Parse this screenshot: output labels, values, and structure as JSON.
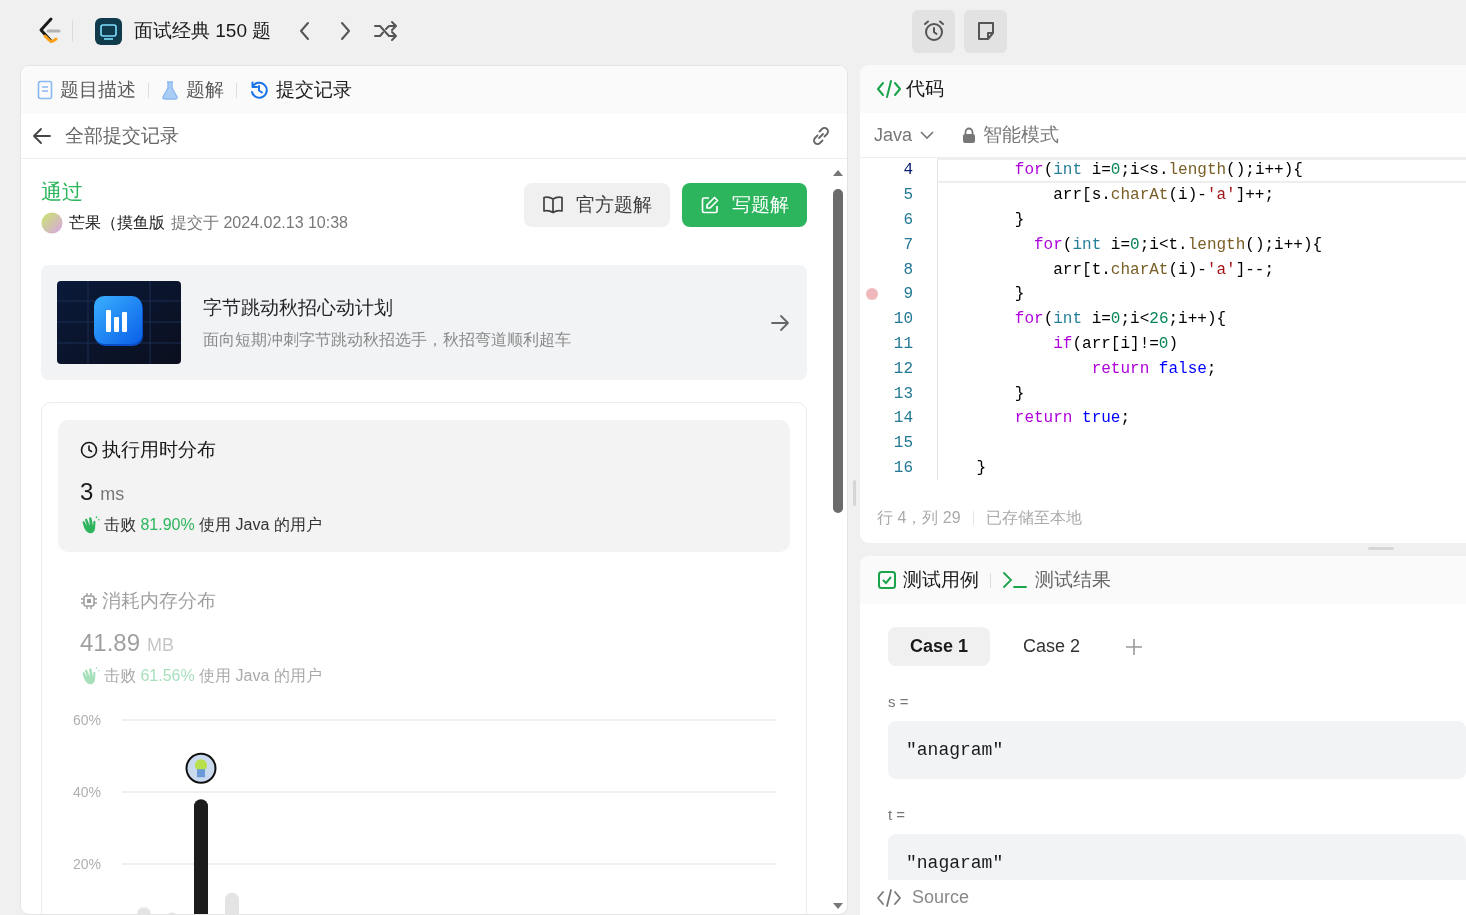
{
  "top_bar": {
    "study_plan_title": "面试经典 150 题"
  },
  "left_panel": {
    "tabs": [
      {
        "label": "题目描述",
        "selected": false
      },
      {
        "label": "题解",
        "selected": false
      },
      {
        "label": "提交记录",
        "selected": true
      }
    ],
    "back_link": "全部提交记录",
    "submission": {
      "status": "通过",
      "user": "芒果（摸鱼版",
      "submitted_at": "提交于 2024.02.13 10:38",
      "buttons": [
        {
          "label": "官方题解",
          "primary": false
        },
        {
          "label": "写题解",
          "primary": true
        }
      ]
    },
    "promo": {
      "title": "字节跳动秋招心动计划",
      "subtitle": "面向短期冲刺字节跳动秋招选手，秋招弯道顺利超车"
    },
    "stats": [
      {
        "title": "执行用时分布",
        "value": "3",
        "unit": "ms",
        "beats_label": "击败",
        "beats": "81.90%",
        "beats_suffix": "使用 Java 的用户",
        "selected": true
      },
      {
        "title": "消耗内存分布",
        "value": "41.89",
        "unit": "MB",
        "beats_label": "击败",
        "beats": "61.56%",
        "beats_suffix": "使用 Java 的用户",
        "selected": false
      }
    ],
    "distribution_chart": {
      "tick_labels": [
        "60%",
        "40%",
        "20%"
      ]
    }
  },
  "code_panel": {
    "title": "代码",
    "language": "Java",
    "mode": "智能模式",
    "lines": [
      {
        "number": "4",
        "current": true,
        "breakpoint": false,
        "tokens": [
          {
            "kind": "keyword",
            "text": "        for"
          },
          {
            "kind": "plain",
            "text": "("
          },
          {
            "kind": "type",
            "text": "int"
          },
          {
            "kind": "plain",
            "text": " i="
          },
          {
            "kind": "number",
            "text": "0"
          },
          {
            "kind": "plain",
            "text": ";i<s."
          },
          {
            "kind": "method",
            "text": "length"
          },
          {
            "kind": "plain",
            "text": "();i++){"
          }
        ]
      },
      {
        "number": "5",
        "current": false,
        "breakpoint": false,
        "tokens": [
          {
            "kind": "plain",
            "text": "            arr[s."
          },
          {
            "kind": "method",
            "text": "charAt"
          },
          {
            "kind": "plain",
            "text": "(i)-"
          },
          {
            "kind": "string",
            "text": "'a'"
          },
          {
            "kind": "plain",
            "text": "]++;"
          }
        ]
      },
      {
        "number": "6",
        "current": false,
        "breakpoint": false,
        "tokens": [
          {
            "kind": "plain",
            "text": "        }"
          }
        ]
      },
      {
        "number": "7",
        "current": false,
        "breakpoint": false,
        "tokens": [
          {
            "kind": "keyword",
            "text": "          for"
          },
          {
            "kind": "plain",
            "text": "("
          },
          {
            "kind": "type",
            "text": "int"
          },
          {
            "kind": "plain",
            "text": " i="
          },
          {
            "kind": "number",
            "text": "0"
          },
          {
            "kind": "plain",
            "text": ";i<t."
          },
          {
            "kind": "method",
            "text": "length"
          },
          {
            "kind": "plain",
            "text": "();i++){"
          }
        ]
      },
      {
        "number": "8",
        "current": false,
        "breakpoint": false,
        "tokens": [
          {
            "kind": "plain",
            "text": "            arr[t."
          },
          {
            "kind": "method",
            "text": "charAt"
          },
          {
            "kind": "plain",
            "text": "(i)-"
          },
          {
            "kind": "string",
            "text": "'a'"
          },
          {
            "kind": "plain",
            "text": "]--;"
          }
        ]
      },
      {
        "number": "9",
        "current": false,
        "breakpoint": true,
        "tokens": [
          {
            "kind": "plain",
            "text": "        }"
          }
        ]
      },
      {
        "number": "10",
        "current": false,
        "breakpoint": false,
        "tokens": [
          {
            "kind": "keyword",
            "text": "        for"
          },
          {
            "kind": "plain",
            "text": "("
          },
          {
            "kind": "type",
            "text": "int"
          },
          {
            "kind": "plain",
            "text": " i="
          },
          {
            "kind": "number",
            "text": "0"
          },
          {
            "kind": "plain",
            "text": ";i<"
          },
          {
            "kind": "number",
            "text": "26"
          },
          {
            "kind": "plain",
            "text": ";i++){"
          }
        ]
      },
      {
        "number": "11",
        "current": false,
        "breakpoint": false,
        "tokens": [
          {
            "kind": "keyword",
            "text": "            if"
          },
          {
            "kind": "plain",
            "text": "(arr[i]!="
          },
          {
            "kind": "number",
            "text": "0"
          },
          {
            "kind": "plain",
            "text": ")"
          }
        ]
      },
      {
        "number": "12",
        "current": false,
        "breakpoint": false,
        "tokens": [
          {
            "kind": "keyword",
            "text": "                return"
          },
          {
            "kind": "literal",
            "text": " false"
          },
          {
            "kind": "plain",
            "text": ";"
          }
        ]
      },
      {
        "number": "13",
        "current": false,
        "breakpoint": false,
        "tokens": [
          {
            "kind": "plain",
            "text": "        }"
          }
        ]
      },
      {
        "number": "14",
        "current": false,
        "breakpoint": false,
        "tokens": [
          {
            "kind": "keyword",
            "text": "        return"
          },
          {
            "kind": "literal",
            "text": " true"
          },
          {
            "kind": "plain",
            "text": ";"
          }
        ]
      },
      {
        "number": "15",
        "current": false,
        "breakpoint": false
      },
      {
        "number": "16",
        "current": false,
        "breakpoint": false,
        "tokens": [
          {
            "kind": "plain",
            "text": "    }"
          }
        ]
      }
    ],
    "cursor": "行 4，列 29",
    "save_status": "已存储至本地"
  },
  "test_panel": {
    "tabs": [
      {
        "label": "测试用例",
        "selected": true
      },
      {
        "label": "测试结果",
        "selected": false
      }
    ],
    "cases": [
      {
        "label": "Case 1",
        "selected": true
      },
      {
        "label": "Case 2",
        "selected": false
      }
    ],
    "params": [
      {
        "name": "s =",
        "value": "\"anagram\""
      },
      {
        "name": "t =",
        "value": "\"nagaram\""
      }
    ],
    "footer": "Source"
  }
}
